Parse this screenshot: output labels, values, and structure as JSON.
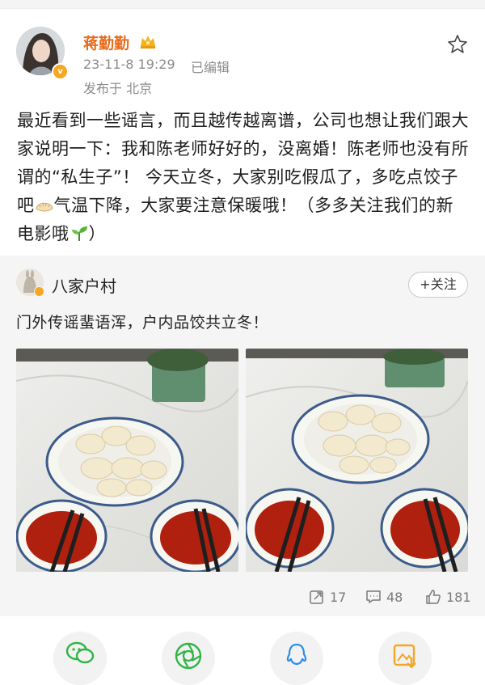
{
  "post": {
    "author_name": "蒋勤勤",
    "timestamp": "23-11-8 19:29",
    "edited_label": "已编辑",
    "location": "发布于 北京",
    "text_part1": "最近看到一些谣言，而且越传越离谱，公司也想让我们跟大家说明一下：我和陈老师好好的，没离婚！陈老师也没有所谓的“私生子”！ 今天立冬，大家别吃假瓜了，多吃点饺子吧",
    "text_part2": "气温下降，大家要注意保暖哦！（多多关注我们的新电影哦",
    "text_part3": "）",
    "icons": {
      "vip": "crown-icon",
      "favorite": "star-icon",
      "verified": "verified-badge-icon"
    }
  },
  "repost": {
    "author_name": "八家户村",
    "follow_label": "+关注",
    "text": "门外传谣蜚语浑，户内品饺共立冬！",
    "images": [
      "dumplings-photo-1",
      "dumplings-photo-2"
    ],
    "stats": {
      "reposts": "17",
      "comments": "48",
      "likes": "181"
    }
  },
  "share_bar": {
    "icons": [
      "wechat-icon",
      "moments-icon",
      "qq-icon",
      "save-image-icon"
    ]
  },
  "colors": {
    "author_name": "#e86b1c",
    "meta": "#8c8c8c",
    "repost_bg": "#f5f5f5"
  }
}
